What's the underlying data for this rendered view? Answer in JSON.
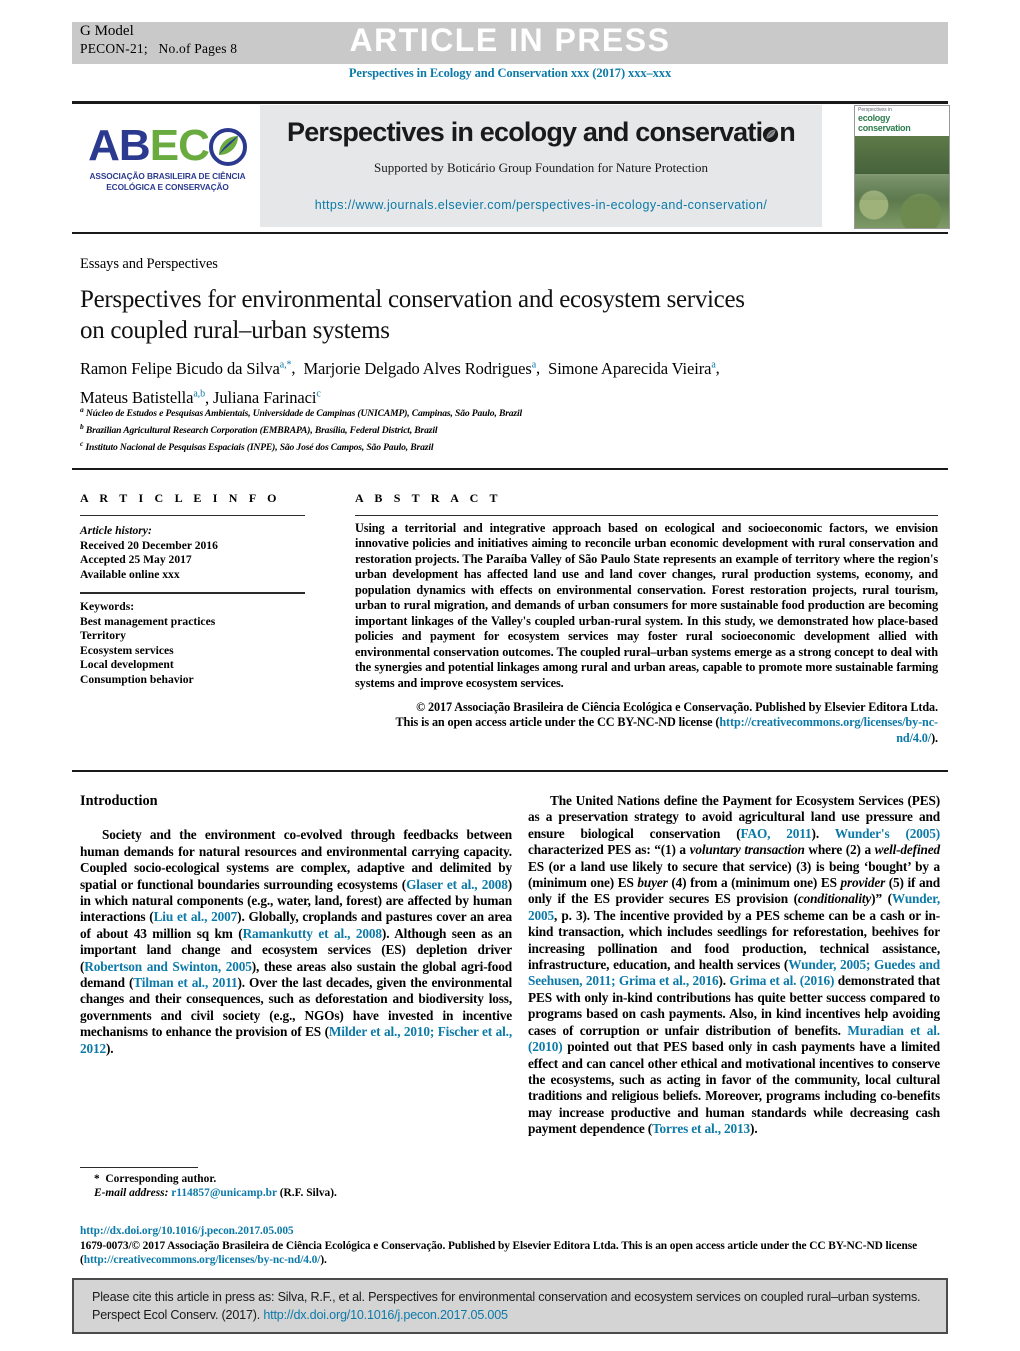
{
  "topbar": {
    "g_model": "G Model",
    "article_id": "PECON-21;",
    "pages": "No.of Pages 8",
    "article_in_press": "ARTICLE IN PRESS",
    "journal_line": "Perspectives in Ecology and Conservation xxx (2017) xxx–xxx"
  },
  "masthead": {
    "logo_ab": "AB",
    "logo_ec": "EC",
    "logo_subtitle_line1": "ASSOCIAÇÃO BRASILEIRA DE CIÊNCIA",
    "logo_subtitle_line2": "ECOLÓGICA E CONSERVAÇÃO",
    "banner_title_main": "Perspectives in ecology and conservati",
    "banner_title_tail": "n",
    "banner_subtitle": "Supported by Boticário Group Foundation for Nature Protection",
    "banner_url": "https://www.journals.elsevier.com/perspectives-in-ecology-and-conservation/",
    "cover_label_small": "Perspectives in",
    "cover_label_big": "ecology",
    "cover_label_big2": "conservation"
  },
  "article": {
    "section_type": "Essays and Perspectives",
    "title_line1": "Perspectives for environmental conservation and ecosystem services",
    "title_line2": "on coupled rural–urban systems",
    "authors": [
      {
        "name": "Ramon Felipe Bicudo da Silva",
        "marks": "a,*"
      },
      {
        "name": "Marjorie Delgado Alves Rodrigues",
        "marks": "a"
      },
      {
        "name": "Simone Aparecida Vieira",
        "marks": "a"
      },
      {
        "name": "Mateus Batistella",
        "marks": "a,b"
      },
      {
        "name": "Juliana Farinaci",
        "marks": "c"
      }
    ],
    "affiliations": [
      {
        "mark": "a",
        "text": "Núcleo de Estudos e Pesquisas Ambientais, Universidade de Campinas (UNICAMP), Campinas, São Paulo, Brazil"
      },
      {
        "mark": "b",
        "text": "Brazilian Agricultural Research Corporation (EMBRAPA), Brasília, Federal District, Brazil"
      },
      {
        "mark": "c",
        "text": "Instituto Nacional de Pesquisas Espaciais (INPE), São José dos Campos, São Paulo, Brazil"
      }
    ]
  },
  "info": {
    "heading": "A R T I C L E   I N F O",
    "history_label": "Article history:",
    "received": "Received 20 December 2016",
    "accepted": "Accepted 25 May 2017",
    "available": "Available online xxx",
    "keywords_label": "Keywords:",
    "keywords": [
      "Best management practices",
      "Territory",
      "Ecosystem services",
      "Local development",
      "Consumption behavior"
    ]
  },
  "abstract": {
    "heading": "A B S T R A C T",
    "body": "Using a territorial and integrative approach based on ecological and socioeconomic factors, we envision innovative policies and initiatives aiming to reconcile urban economic development with rural conservation and restoration projects. The Paraíba Valley of São Paulo State represents an example of territory where the region's urban development has affected land use and land cover changes, rural production systems, economy, and population dynamics with effects on environmental conservation. Forest restoration projects, rural tourism, urban to rural migration, and demands of urban consumers for more sustainable food production are becoming important linkages of the Valley's coupled urban-rural system. In this study, we demonstrated how place-based policies and payment for ecosystem services may foster rural socioeconomic development allied with environmental conservation outcomes. The coupled rural–urban systems emerge as a strong concept to deal with the synergies and potential linkages among rural and urban areas, capable to promote more sustainable farming systems and improve ecosystem services.",
    "copyright_line1": "© 2017 Associação Brasileira de Ciência Ecológica e Conservação. Published by Elsevier Editora Ltda.",
    "copyright_line2_pre": "This is an open access article under the CC BY-NC-ND license (",
    "copyright_link": "http://creativecommons.org/licenses/by-nc-nd/4.0/",
    "copyright_line2_post": ")."
  },
  "body": {
    "intro_heading": "Introduction",
    "left_paragraph_1_a": "Society and the environment co-evolved through feedbacks between human demands for natural resources and environmental carrying capacity. Coupled socio-ecological systems are complex, adaptive and delimited by spatial or functional boundaries surrounding ecosystems (",
    "cite_glaser": "Glaser et al., 2008",
    "left_paragraph_1_b": ") in which natural components (e.g., water, land, forest) are affected by human interactions (",
    "cite_liu": "Liu et al., 2007",
    "left_paragraph_1_c": "). Globally, croplands and pastures cover an area of about 43 million sq km (",
    "cite_ramankutty": "Ramankutty et al., 2008",
    "left_paragraph_1_d": "). Although seen as an important land change and ecosystem services (ES) depletion driver (",
    "cite_robertson": "Robertson and Swinton, 2005",
    "left_paragraph_1_e": "), these areas also sustain the global agri-food demand (",
    "cite_tilman": "Tilman et al., 2011",
    "left_paragraph_1_f": "). Over the last decades, given the environmental changes and their consequences, such as deforestation and biodiversity loss, governments and civil society (e.g., NGOs) have invested in incentive mechanisms to enhance the provision of ES (",
    "cite_milder": "Milder et al., 2010; Fischer et al., 2012",
    "left_paragraph_1_g": ").",
    "right_paragraph_1_a": "The United Nations define the Payment for Ecosystem Services (PES) as a preservation strategy to avoid agricultural land use pressure and ensure biological conservation (",
    "cite_fao": "FAO, 2011",
    "right_paragraph_1_b": "). ",
    "cite_wunder2005": "Wunder's (2005)",
    "right_paragraph_1_c": " characterized PES as: “(1) a ",
    "it_voluntary": "voluntary transaction",
    "right_paragraph_1_d": " where (2) a ",
    "it_welldefined": "well-defined",
    "right_paragraph_1_e": " ES (or a land use likely to secure that service) (3) is being ‘bought’ by a (minimum one) ES ",
    "it_buyer": "buyer",
    "right_paragraph_1_f": " (4) from a (minimum one) ES ",
    "it_provider": "provider",
    "right_paragraph_1_g": " (5) if and only if the ES provider secures ES provision (",
    "it_conditionality": "conditionality",
    "right_paragraph_1_h": ")” (",
    "cite_wunder": "Wunder, 2005",
    "right_paragraph_1_i": ", p. 3). The incentive provided by a PES scheme can be a cash or in-kind transaction, which includes seedlings for reforestation, beehives for increasing pollination and food production, technical assistance, infrastructure, education, and health services (",
    "cite_wunder_guedes": "Wunder, 2005; Guedes and Seehusen, 2011; Grima et al., 2016",
    "right_paragraph_1_j": "). ",
    "cite_grima": "Grima et al. (2016)",
    "right_paragraph_1_k": " demonstrated that PES with only in-kind contributions has quite better success compared to programs based on cash payments. Also, in kind incentives help avoiding cases of corruption or unfair distribution of benefits. ",
    "cite_muradian": "Muradian et al. (2010)",
    "right_paragraph_1_l": " pointed out that PES based only in cash payments have a limited effect and can cancel other ethical and motivational incentives to conserve the ecosystems, such as acting in favor of the community, local cultural traditions and religious beliefs. Moreover, programs including co-benefits may increase productive and human standards while decreasing cash payment dependence (",
    "cite_torres": "Torres et al., 2013",
    "right_paragraph_1_m": ")."
  },
  "footer": {
    "corresponding_marker": "*",
    "corresponding_label": "Corresponding author.",
    "email_label": "E-mail address:",
    "email": "r114857@unicamp.br",
    "email_owner": "(R.F. Silva).",
    "doi_link": "http://dx.doi.org/10.1016/j.pecon.2017.05.005",
    "issn_line_pre": "1679-0073/© 2017 Associação Brasileira de Ciência Ecológica e Conservação. Published by Elsevier Editora Ltda. This is an open access article under the CC BY-NC-ND license",
    "license_open_paren": "(",
    "license_link": "http://creativecommons.org/licenses/by-nc-nd/4.0/",
    "license_close_paren": ")."
  },
  "citebox": {
    "text_pre": "Please cite this article in press as: Silva, R.F., et al. Perspectives for environmental conservation and ecosystem services on coupled rural–urban systems. Perspect Ecol Conserv. (2017). ",
    "link": "http://dx.doi.org/10.1016/j.pecon.2017.05.005"
  },
  "colors": {
    "link": "#0c7aa8",
    "logo_blue": "#2b3a8f",
    "logo_green": "#6aab3f",
    "topbar_grey": "#c9c9c9",
    "banner_grey": "#e6e7e9",
    "citebox_grey": "#d4d4d4"
  }
}
